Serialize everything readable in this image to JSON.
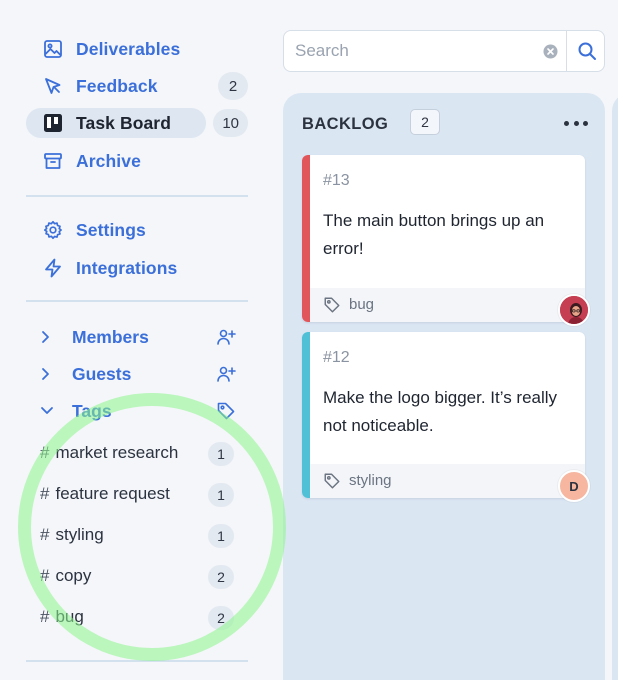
{
  "sidebar": {
    "nav": [
      {
        "label": "Deliverables",
        "icon": "image-icon"
      },
      {
        "label": "Feedback",
        "icon": "cursor-icon",
        "count": "2"
      },
      {
        "label": "Task Board",
        "icon": "board-icon",
        "count": "10",
        "active": true
      },
      {
        "label": "Archive",
        "icon": "archive-icon"
      }
    ],
    "settings": [
      {
        "label": "Settings",
        "icon": "gear-icon"
      },
      {
        "label": "Integrations",
        "icon": "bolt-icon"
      }
    ],
    "sections": [
      {
        "label": "Members",
        "icon": "add-user-icon"
      },
      {
        "label": "Guests",
        "icon": "add-user-icon"
      },
      {
        "label": "Tags",
        "icon": "tag-icon"
      }
    ],
    "tags": [
      {
        "name": "market research",
        "count": "1"
      },
      {
        "name": "feature request",
        "count": "1"
      },
      {
        "name": "styling",
        "count": "1"
      },
      {
        "name": "copy",
        "count": "2"
      },
      {
        "name": "bug",
        "count": "2"
      }
    ],
    "hash": "#"
  },
  "search": {
    "placeholder": "Search",
    "value": ""
  },
  "board": {
    "column": {
      "title": "BACKLOG",
      "count": "2"
    },
    "cards": [
      {
        "id": "#13",
        "title": "The main button brings up an error!",
        "tag": "bug",
        "stripe_color": "#e0565b",
        "assignee": "photo"
      },
      {
        "id": "#12",
        "title": "Make the logo bigger. It’s really not noticeable.",
        "tag": "styling",
        "stripe_color": "#4fc0d6",
        "assignee": "D"
      }
    ]
  },
  "colors": {
    "accent": "#3b6fd9",
    "column_bg": "#dbe6f3",
    "highlight_circle": "#8cf58c"
  }
}
